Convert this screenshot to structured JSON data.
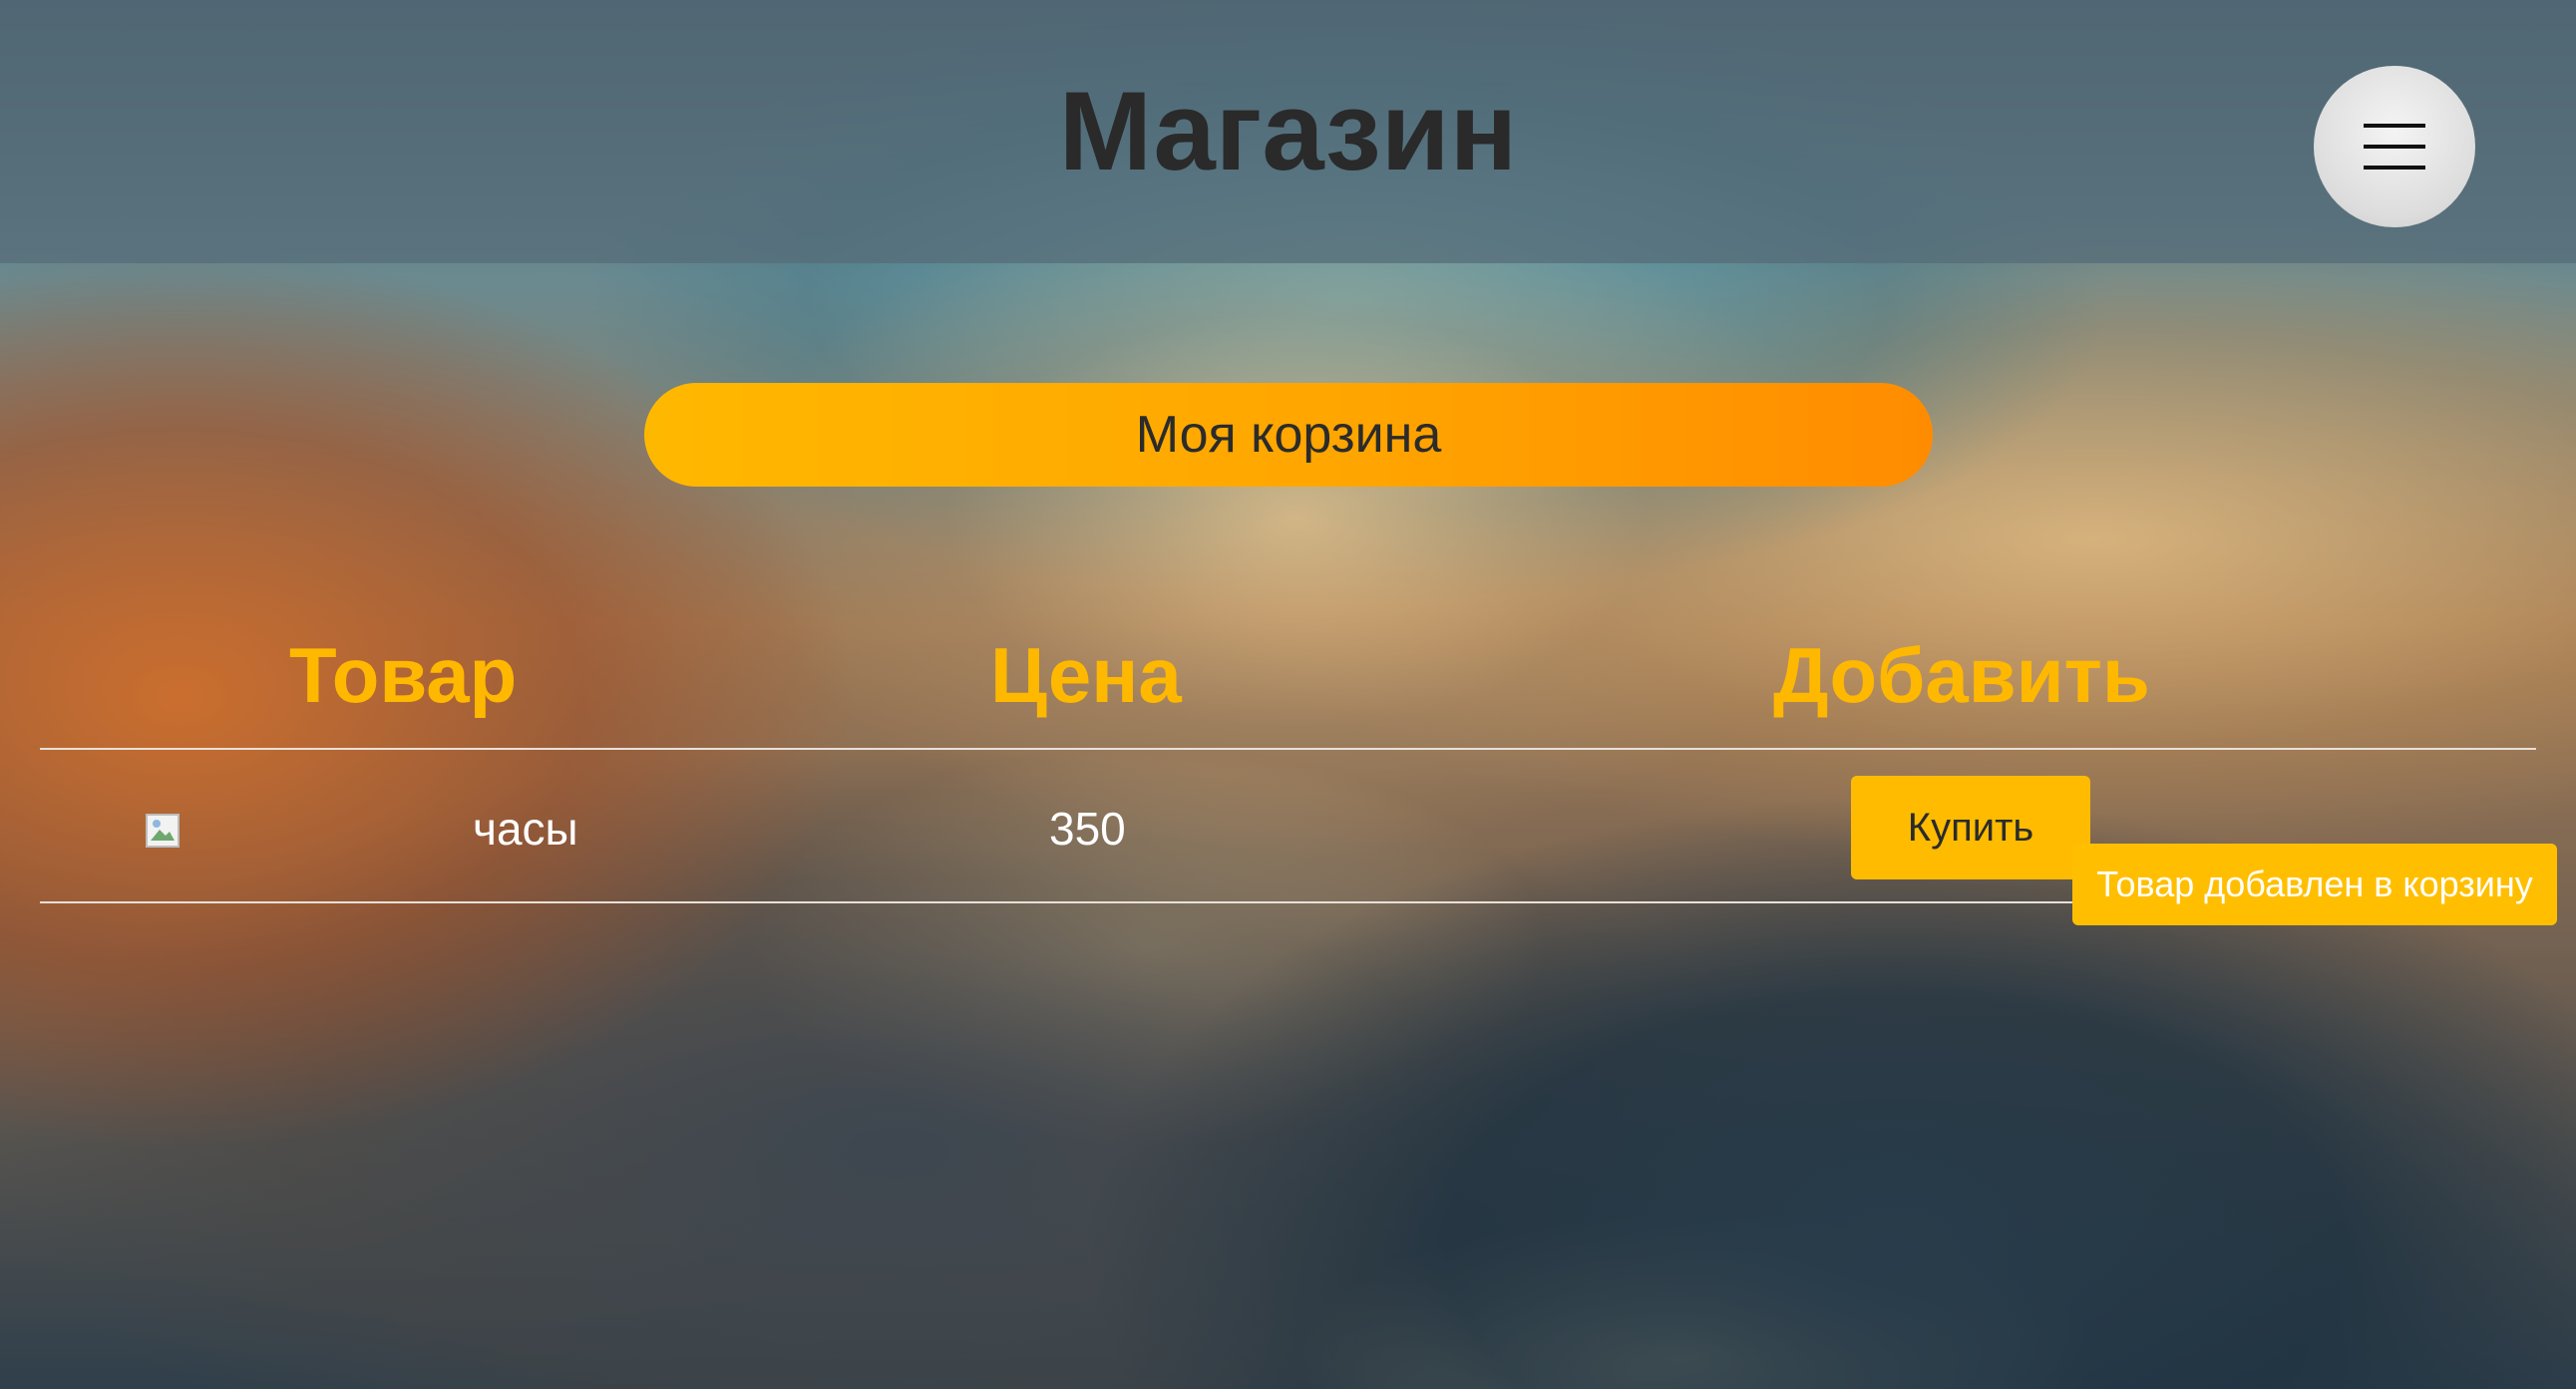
{
  "header": {
    "title": "Магазин",
    "menu_icon": "hamburger-menu-icon"
  },
  "cart": {
    "label": "Моя корзина"
  },
  "table": {
    "columns": [
      "Товар",
      "Цена",
      "Добавить"
    ],
    "rows": [
      {
        "image_icon": "broken-image-icon",
        "name": "часы",
        "price": "350",
        "action_label": "Купить"
      }
    ]
  },
  "notification": {
    "text": "Товар добавлен в корзину"
  },
  "colors": {
    "accent": "#ffb800",
    "accent_end": "#ff8c00",
    "header_overlay": "#556c78",
    "text_dark": "#2a2a2a",
    "text_light": "#ffffff"
  }
}
